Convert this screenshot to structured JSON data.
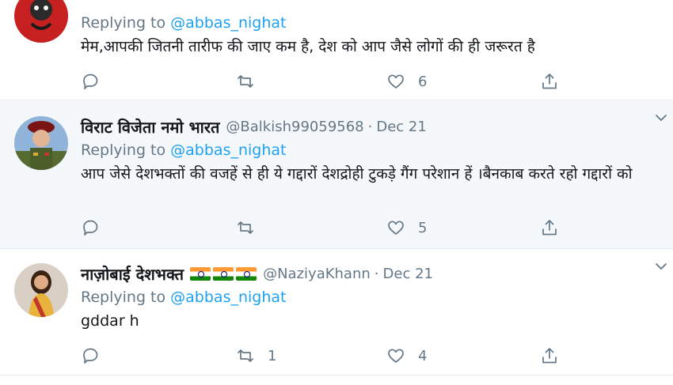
{
  "colors": {
    "link": "#1da1f2",
    "muted": "#657786",
    "text": "#14171a",
    "highlight_bg": "#f5f8fa"
  },
  "tweets": [
    {
      "name": "",
      "handle": "",
      "date": "",
      "replying_prefix": "Replying to ",
      "replying_to": "@abbas_nighat",
      "text": "मेम,आपकी जितनी तारीफ की जाए कम है, देश को आप जैसे लोगों की ही जरूरत है",
      "retweets": "",
      "likes": "6"
    },
    {
      "name": "विराट विजेता नमो भारत",
      "handle": "@Balkish99059568",
      "separator": "·",
      "date": "Dec 21",
      "replying_prefix": "Replying to ",
      "replying_to": "@abbas_nighat",
      "text": "आप जेसे देशभक्तों की वजहें से ही ये गद्दारों देशद्रोही टुकड़े गैंग परेशान हें ।बैनकाब करते रहो गद्दारों को",
      "retweets": "",
      "likes": "5"
    },
    {
      "name": "नाज़ोबाई देशभक्त",
      "flags": "🇮🇳🇮🇳🇮🇳",
      "handle": "@NaziyaKhann",
      "separator": "·",
      "date": "Dec 21",
      "replying_prefix": "Replying to ",
      "replying_to": "@abbas_nighat",
      "text": "gddar h",
      "retweets": "1",
      "likes": "4"
    }
  ]
}
